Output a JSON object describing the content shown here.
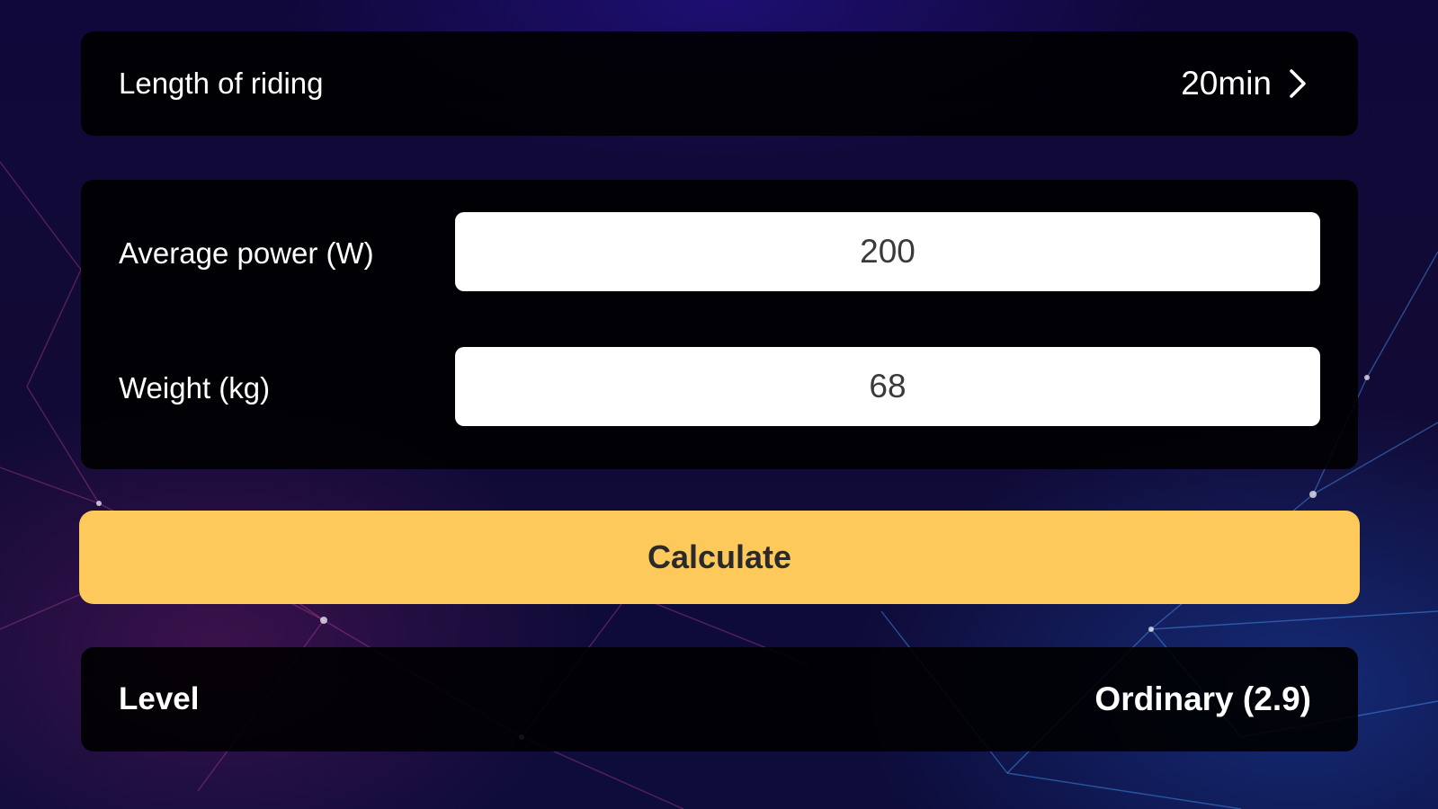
{
  "riding": {
    "label": "Length of riding",
    "value": "20min",
    "icon": "chevron-right-icon"
  },
  "inputs": {
    "power": {
      "label": "Average power (W)",
      "value": "200"
    },
    "weight": {
      "label": "Weight (kg)",
      "value": "68"
    }
  },
  "calculate": {
    "label": "Calculate",
    "color": "#fcc95a"
  },
  "result": {
    "label": "Level",
    "value": "Ordinary (2.9)"
  },
  "theme": {
    "card_background": "#000000",
    "text_color": "#ffffff"
  }
}
